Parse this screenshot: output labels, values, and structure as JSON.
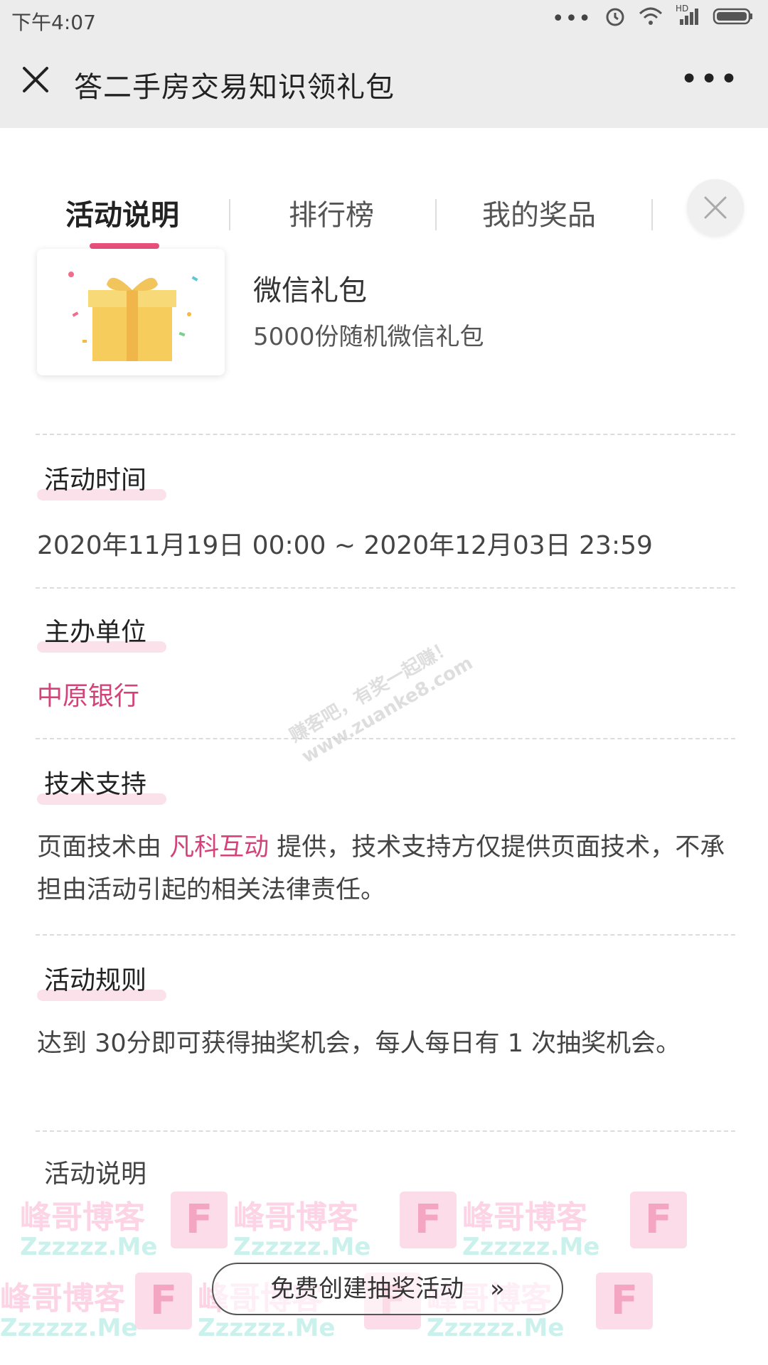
{
  "status_bar": {
    "time": "下午4:07",
    "icons": [
      "more-dots-icon",
      "alarm-icon",
      "wifi-icon",
      "signal-icon",
      "battery-icon"
    ],
    "signal_label": "HD"
  },
  "app_bar": {
    "title": "答二手房交易知识领礼包",
    "more": "•••"
  },
  "tabs": [
    {
      "label": "活动说明",
      "active": true
    },
    {
      "label": "排行榜",
      "active": false
    },
    {
      "label": "我的奖品",
      "active": false
    }
  ],
  "prize": {
    "name": "微信礼包",
    "description": "5000份随机微信礼包"
  },
  "sections": {
    "time": {
      "title": "活动时间",
      "text": "2020年11月19日 00:00 ~ 2020年12月03日 23:59"
    },
    "organizer": {
      "title": "主办单位",
      "text": "中原银行"
    },
    "tech": {
      "title": "技术支持",
      "text_before": "页面技术由 ",
      "highlight": "凡科互动",
      "text_after": " 提供，技术支持方仅提供页面技术，不承担由活动引起的相关法律责任。"
    },
    "rules": {
      "title": "活动规则",
      "text": "达到 30分即可获得抽奖机会，每人每日有 1 次抽奖机会。"
    },
    "description": {
      "title": "活动说明"
    }
  },
  "watermarks": {
    "diagonal_line1": "赚客吧，有奖一起赚！",
    "diagonal_line2": "www.zuanke8.com",
    "brand": "峰哥博客",
    "brand_sub": "Zzzzzz.Me",
    "logo_letter": "F"
  },
  "footer": {
    "create_button": "免费创建抽奖活动",
    "chevron": "»"
  },
  "colors": {
    "accent": "#e8507a",
    "highlight_text": "#d4427a",
    "section_highlight": "#fbe2ea",
    "appbar_bg": "#ececec"
  }
}
